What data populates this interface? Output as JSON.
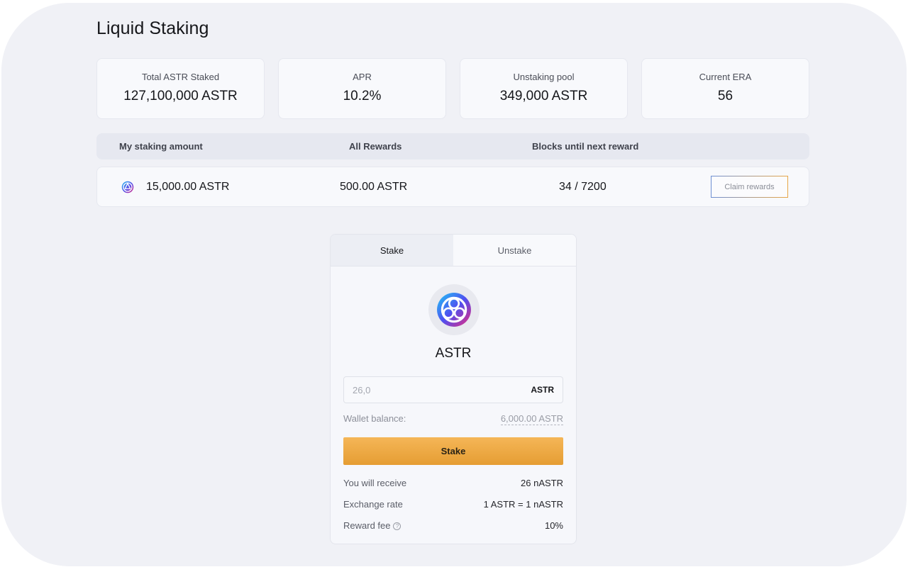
{
  "page": {
    "title": "Liquid Staking"
  },
  "stats": [
    {
      "label": "Total ASTR Staked",
      "value": "127,100,000 ASTR"
    },
    {
      "label": "APR",
      "value": "10.2%"
    },
    {
      "label": "Unstaking pool",
      "value": "349,000 ASTR"
    },
    {
      "label": "Current ERA",
      "value": "56"
    }
  ],
  "summary": {
    "headers": {
      "staking_amount": "My staking amount",
      "rewards": "All Rewards",
      "blocks": "Blocks until next reward"
    },
    "row": {
      "token_icon": "astar-token-icon",
      "staking_amount": "15,000.00 ASTR",
      "rewards": "500.00 ASTR",
      "blocks": "34 / 7200",
      "claim_label": "Claim rewards"
    }
  },
  "panel": {
    "tabs": [
      {
        "label": "Stake",
        "active": true
      },
      {
        "label": "Unstake",
        "active": false
      }
    ],
    "token": {
      "icon": "astar-logo-icon",
      "name": "ASTR"
    },
    "amount": {
      "value": "26,0",
      "unit": "ASTR"
    },
    "wallet_balance": {
      "label": "Wallet balance:",
      "value": "6,000.00  ASTR"
    },
    "stake_button": "Stake",
    "info": [
      {
        "label": "You will receive",
        "value": "26 nASTR"
      },
      {
        "label": "Exchange rate",
        "value": "1 ASTR = 1 nASTR"
      },
      {
        "label": "Reward fee",
        "value": "10%",
        "help_icon": "question-circle-icon"
      }
    ]
  },
  "colors": {
    "background": "#f0f1f6",
    "accent_orange": "#e8a646",
    "accent_blue": "#6d8fd4"
  }
}
